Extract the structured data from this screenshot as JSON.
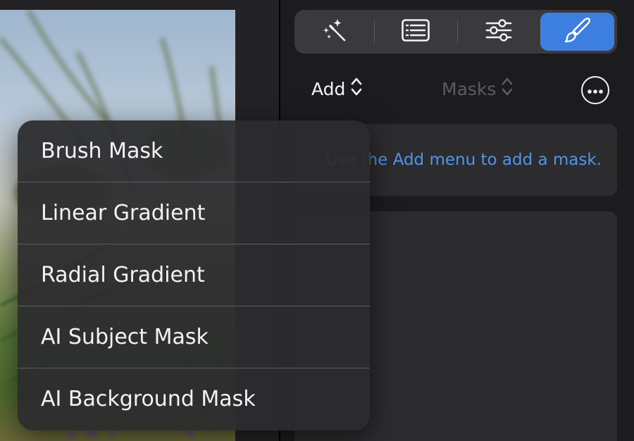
{
  "toolbar": {
    "tabs": [
      {
        "name": "auto-enhance",
        "icon": "magic-wand-icon",
        "active": false
      },
      {
        "name": "presets",
        "icon": "list-icon",
        "active": false
      },
      {
        "name": "adjustments",
        "icon": "sliders-icon",
        "active": false
      },
      {
        "name": "masks",
        "icon": "brush-icon",
        "active": true
      }
    ],
    "accent_color": "#3d7fe0"
  },
  "controls": {
    "add_label": "Add",
    "masks_label": "Masks",
    "more_icon": "ellipsis-icon"
  },
  "hint": {
    "text": "Use the Add menu to add a mask.",
    "color": "#4f96ea"
  },
  "add_menu": {
    "items": [
      {
        "label": "Brush Mask"
      },
      {
        "label": "Linear Gradient"
      },
      {
        "label": "Radial Gradient"
      },
      {
        "label": "AI Subject Mask"
      },
      {
        "label": "AI Background Mask"
      }
    ]
  }
}
